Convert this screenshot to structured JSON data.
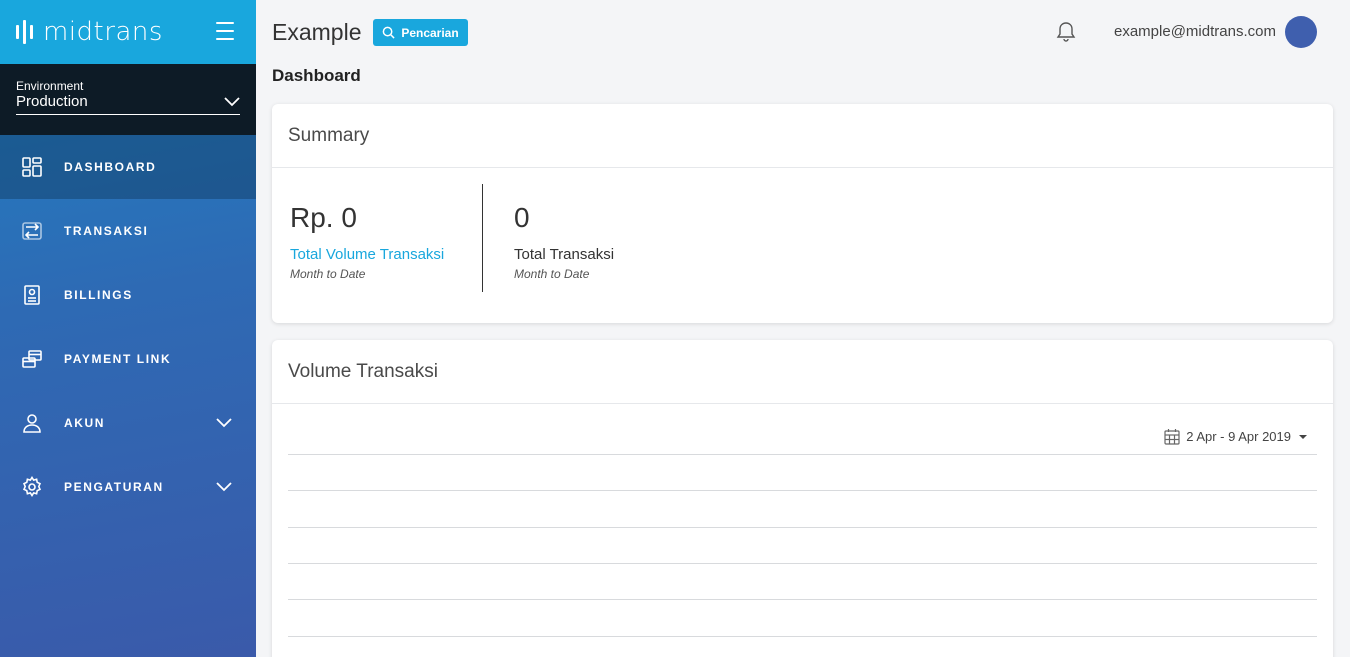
{
  "brand": {
    "name": "midtrans",
    "accent": "#19a7dd"
  },
  "environment": {
    "label": "Environment",
    "value": "Production"
  },
  "nav": [
    {
      "key": "dashboard",
      "label": "DASHBOARD",
      "icon": "dashboard-icon",
      "active": true,
      "expandable": false
    },
    {
      "key": "transaksi",
      "label": "TRANSAKSI",
      "icon": "transaction-icon",
      "active": false,
      "expandable": false
    },
    {
      "key": "billings",
      "label": "BILLINGS",
      "icon": "billing-icon",
      "active": false,
      "expandable": false
    },
    {
      "key": "payment-link",
      "label": "PAYMENT LINK",
      "icon": "payment-link-icon",
      "active": false,
      "expandable": false
    },
    {
      "key": "akun",
      "label": "AKUN",
      "icon": "user-icon",
      "active": false,
      "expandable": true
    },
    {
      "key": "pengaturan",
      "label": "PENGATURAN",
      "icon": "gear-icon",
      "active": false,
      "expandable": true
    }
  ],
  "header": {
    "site_name": "Example",
    "search_label": "Pencarian",
    "user_email": "example@midtrans.com"
  },
  "page": {
    "title": "Dashboard"
  },
  "summary": {
    "title": "Summary",
    "volume": {
      "value": "Rp. 0",
      "label": "Total Volume Transaksi",
      "sub": "Month to Date",
      "label_color": "#19a7dd"
    },
    "count": {
      "value": "0",
      "label": "Total Transaksi",
      "sub": "Month to Date"
    }
  },
  "volume_chart": {
    "title": "Volume Transaksi",
    "date_range": "2 Apr - 9 Apr 2019"
  }
}
